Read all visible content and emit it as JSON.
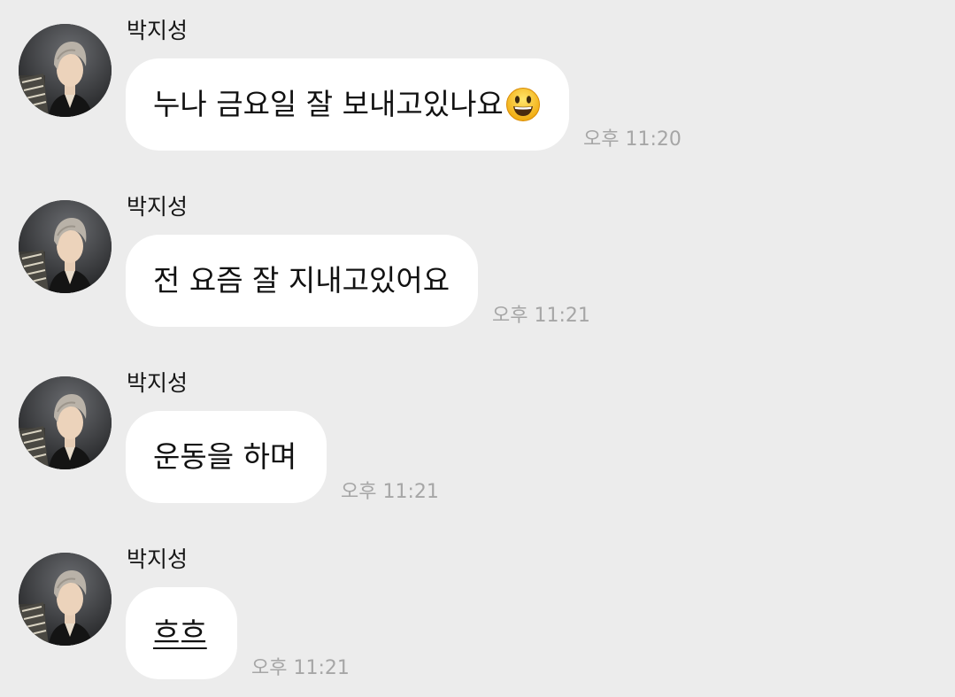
{
  "chat": {
    "messages": [
      {
        "sender": "박지성",
        "text": "누나 금요일 잘 보내고있나요",
        "emoji": "smiling-face-emoji",
        "time": "오후 11:20"
      },
      {
        "sender": "박지성",
        "text": "전 요즘 잘 지내고있어요",
        "time": "오후 11:21"
      },
      {
        "sender": "박지성",
        "text": "운동을 하며",
        "time": "오후 11:21"
      },
      {
        "sender": "박지성",
        "text": "흐흐",
        "time": "오후 11:21"
      }
    ]
  },
  "colors": {
    "background": "#ececec",
    "bubble": "#ffffff",
    "time_text": "#a6a6a6",
    "text": "#111111"
  },
  "icons": {
    "avatar": "profile-photo-avatar",
    "emoji": "smiling-face-emoji"
  }
}
